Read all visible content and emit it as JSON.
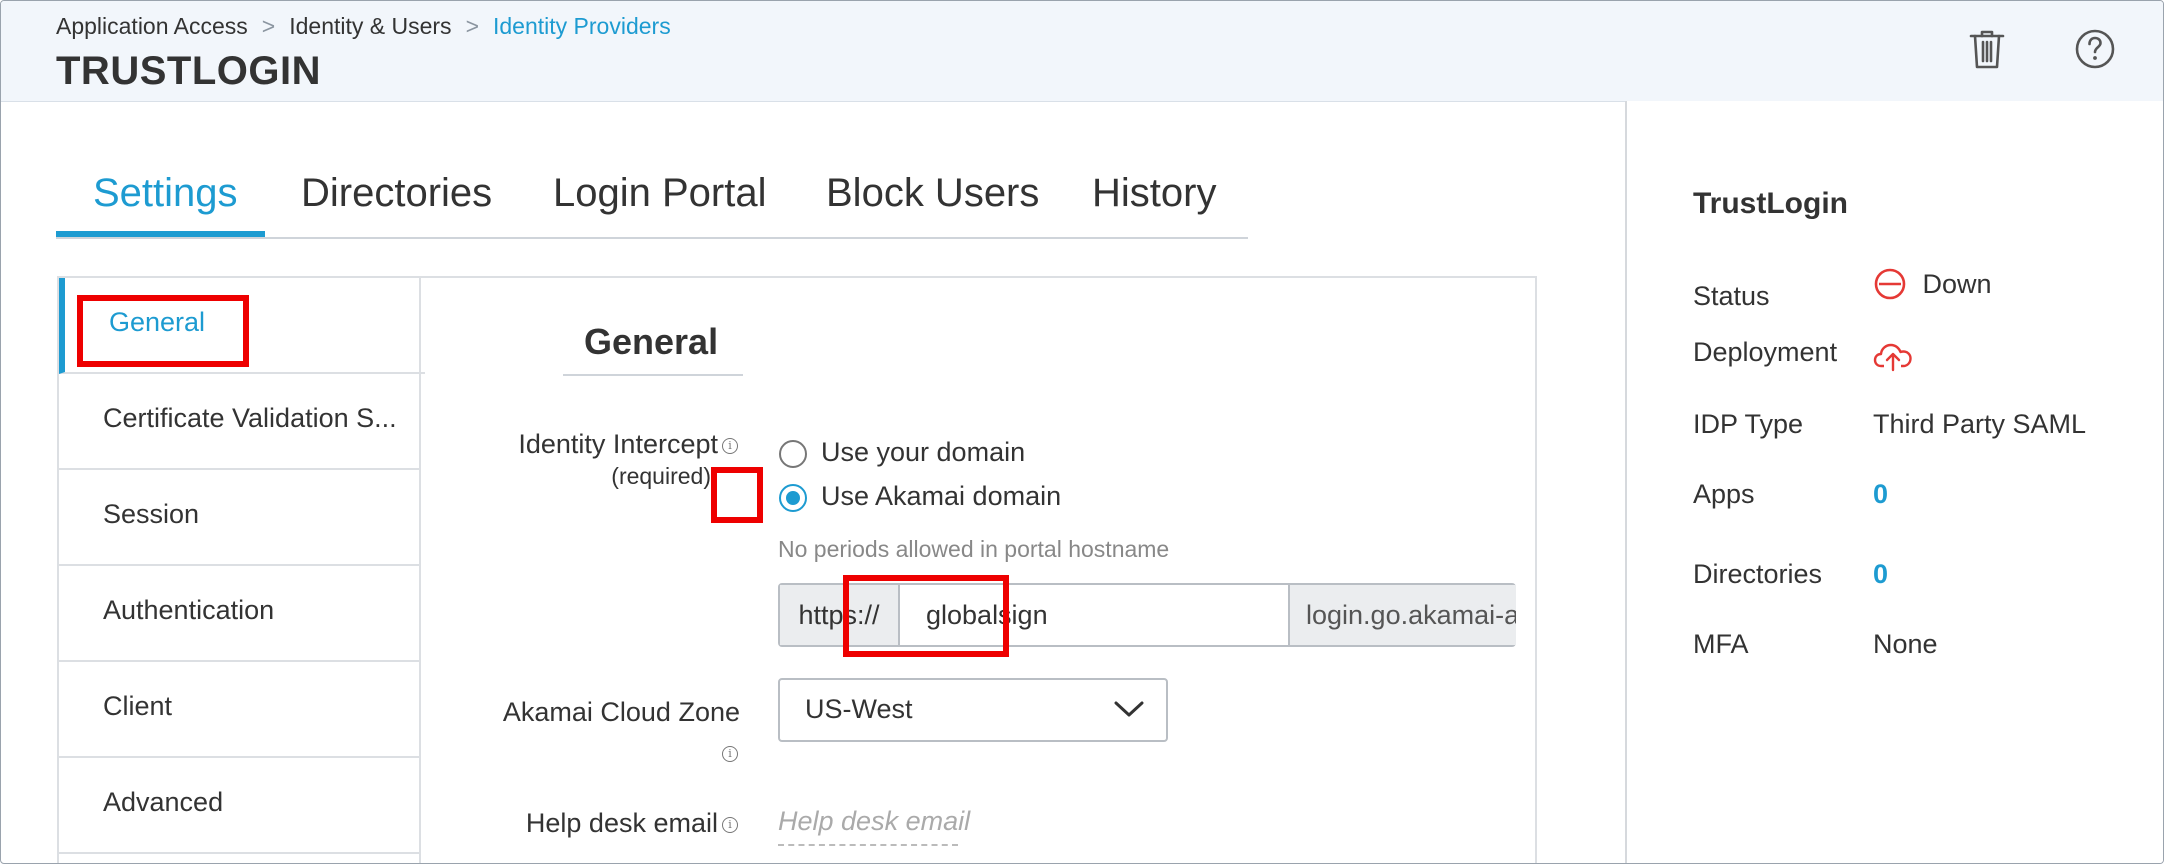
{
  "breadcrumb": {
    "items": [
      "Application Access",
      "Identity & Users",
      "Identity Providers"
    ],
    "separator": ">"
  },
  "page": {
    "title": "TRUSTLOGIN"
  },
  "header_actions": {
    "delete_icon": "trash-icon",
    "help_icon": "help-circle-icon"
  },
  "tabs": [
    "Settings",
    "Directories",
    "Login Portal",
    "Block Users",
    "History"
  ],
  "active_tab": "Settings",
  "side_nav": [
    "General",
    "Certificate Validation S...",
    "Session",
    "Authentication",
    "Client",
    "Advanced"
  ],
  "active_nav": "General",
  "section": {
    "title": "General"
  },
  "identity_intercept": {
    "label": "Identity Intercept",
    "required": "(required)",
    "options": [
      "Use your domain",
      "Use Akamai domain"
    ],
    "selected": "Use Akamai domain",
    "hint": "No periods allowed in portal hostname",
    "prefix": "https://",
    "value": "globalsign",
    "suffix": "login.go.akamai-a..."
  },
  "cloud_zone": {
    "label": "Akamai Cloud Zone",
    "value": "US-West"
  },
  "help_desk": {
    "label": "Help desk email",
    "placeholder": "Help desk email"
  },
  "summary": {
    "title": "TrustLogin",
    "status_label": "Status",
    "status_value": "Down",
    "deployment_label": "Deployment",
    "idp_type_label": "IDP Type",
    "idp_type_value": "Third Party SAML",
    "apps_label": "Apps",
    "apps_value": "0",
    "directories_label": "Directories",
    "directories_value": "0",
    "mfa_label": "MFA",
    "mfa_value": "None"
  },
  "colors": {
    "accent": "#1d9bd1",
    "highlight": "#ee0000",
    "status_down": "#e53935"
  }
}
